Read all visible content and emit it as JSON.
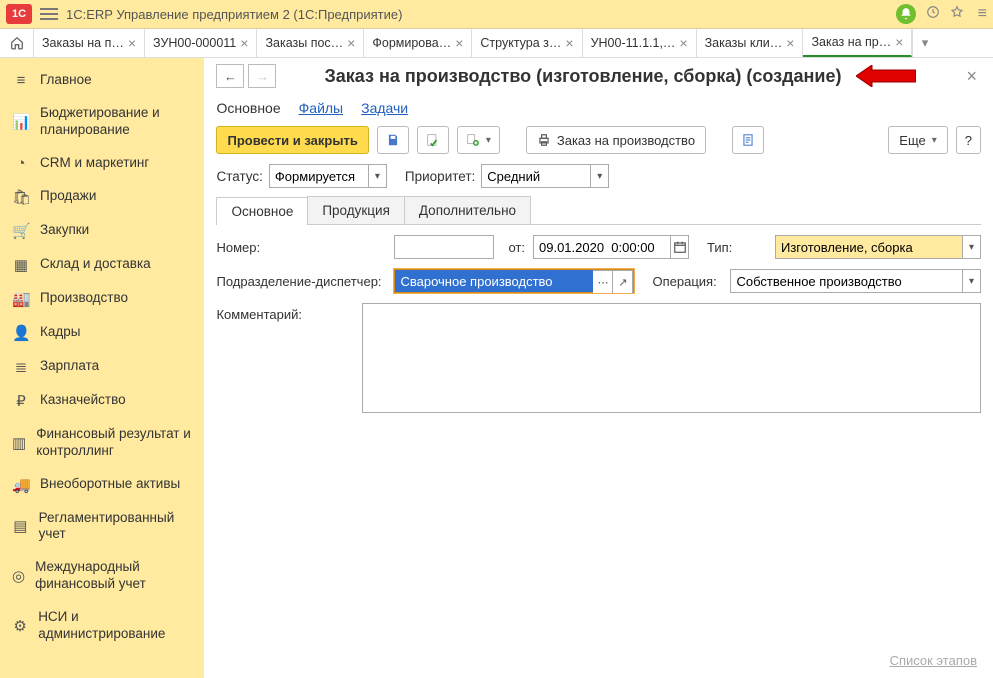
{
  "sysbar": {
    "title": "1С:ERP Управление предприятием 2  (1С:Предприятие)"
  },
  "tabs": [
    "Заказы на п…",
    "ЗУН00-000011",
    "Заказы пос…",
    "Формирова…",
    "Структура з…",
    "УН00-11.1.1,…",
    "Заказы кли…",
    "Заказ на пр…"
  ],
  "sidebar": [
    "Главное",
    "Бюджетирование и планирование",
    "CRM и маркетинг",
    "Продажи",
    "Закупки",
    "Склад и доставка",
    "Производство",
    "Кадры",
    "Зарплата",
    "Казначейство",
    "Финансовый результат и контроллинг",
    "Внеоборотные активы",
    "Регламентированный учет",
    "Международный финансовый учет",
    "НСИ и администрирование"
  ],
  "page": {
    "title": "Заказ на производство (изготовление, сборка) (создание)"
  },
  "subtabs": {
    "main": "Основное",
    "files": "Файлы",
    "tasks": "Задачи"
  },
  "toolbar": {
    "post_close": "Провести и закрыть",
    "print_order": "Заказ на производство",
    "more": "Еще",
    "help": "?"
  },
  "status": {
    "label": "Статус:",
    "value": "Формируется"
  },
  "priority": {
    "label": "Приоритет:",
    "value": "Средний"
  },
  "doctabs": {
    "main": "Основное",
    "products": "Продукция",
    "extra": "Дополнительно"
  },
  "fields": {
    "number_label": "Номер:",
    "number_value": "",
    "from_label": "от:",
    "date_value": "09.01.2020  0:00:00",
    "type_label": "Тип:",
    "type_value": "Изготовление, сборка",
    "unit_label": "Подразделение-диспетчер:",
    "unit_value": "Сварочное производство",
    "op_label": "Операция:",
    "op_value": "Собственное производство",
    "comment_label": "Комментарий:",
    "comment_value": ""
  },
  "footer_link": "Список этапов"
}
